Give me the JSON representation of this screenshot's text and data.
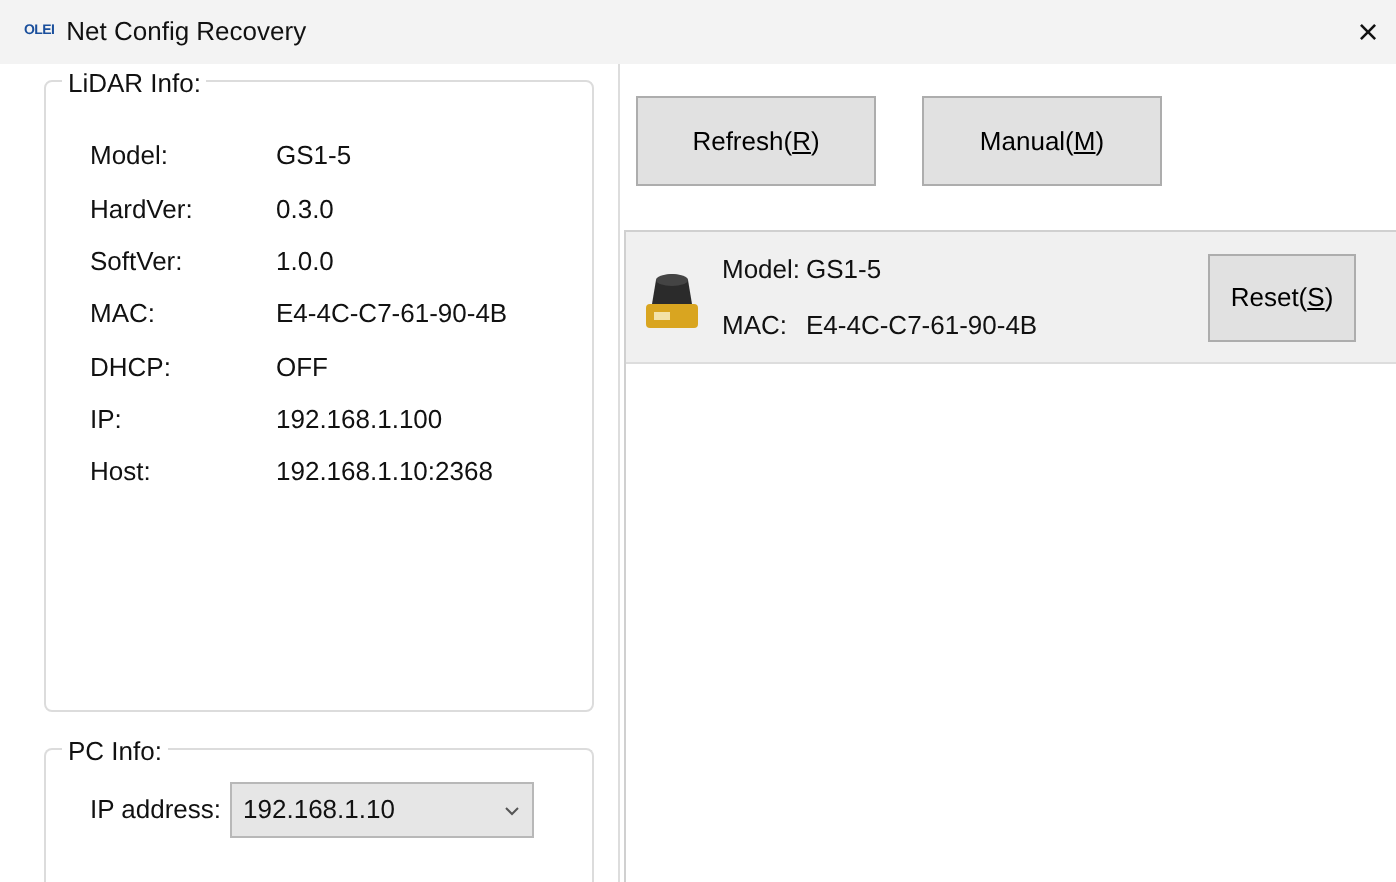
{
  "window": {
    "logo": "OLEI",
    "title": "Net Config Recovery",
    "close": "×"
  },
  "lidar_info": {
    "title": "LiDAR Info:",
    "fields": [
      {
        "label": "Model:",
        "value": "GS1-5"
      },
      {
        "label": "HardVer:",
        "value": "0.3.0"
      },
      {
        "label": "SoftVer:",
        "value": "1.0.0"
      },
      {
        "label": "MAC:",
        "value": "E4-4C-C7-61-90-4B"
      },
      {
        "label": "DHCP:",
        "value": "OFF"
      },
      {
        "label": "IP:",
        "value": "192.168.1.100"
      },
      {
        "label": "Host:",
        "value": "192.168.1.10:2368"
      }
    ]
  },
  "pc_info": {
    "title": "PC Info:",
    "ip_label": "IP address:",
    "ip_value": "192.168.1.10"
  },
  "buttons": [
    {
      "before": "Refresh(",
      "key": "R",
      "after": ")"
    },
    {
      "before": "Manual(",
      "key": "M",
      "after": ")"
    }
  ],
  "devices": [
    {
      "model_label": "Model:",
      "model": "GS1-5",
      "mac_label": "MAC:",
      "mac": "E4-4C-C7-61-90-4B",
      "selected": true,
      "reset": {
        "before": "Reset(",
        "key": "S",
        "after": ")"
      }
    }
  ]
}
